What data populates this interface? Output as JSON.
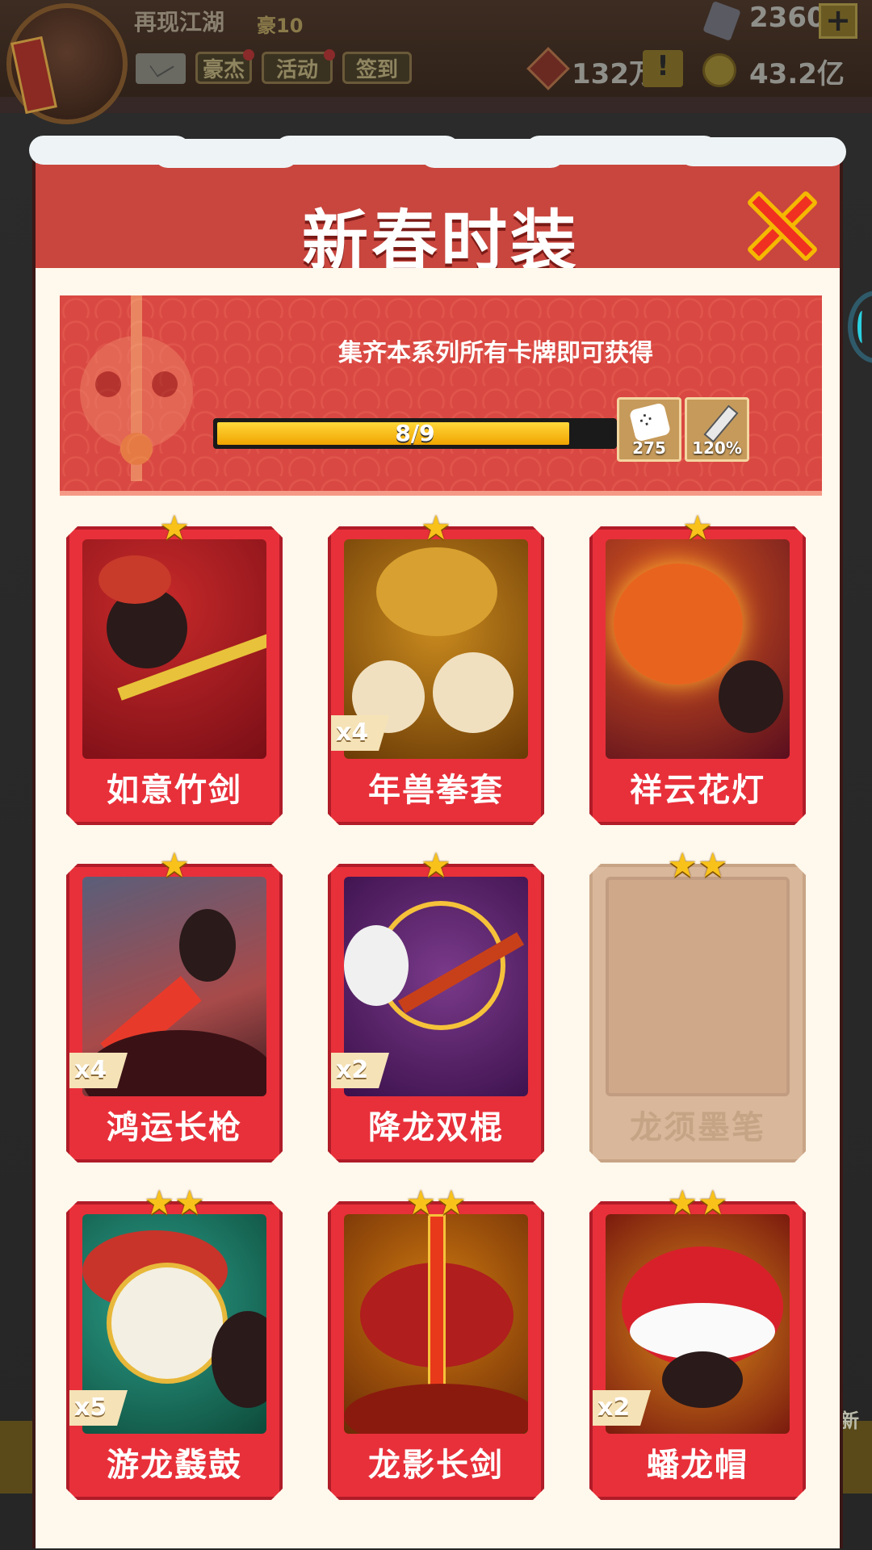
{
  "hud": {
    "player_name": "再现江湖",
    "player_level": "豪10",
    "buttons": [
      "豪杰",
      "活动",
      "签到"
    ],
    "gems": "2360",
    "plus_label": "+",
    "tickets": "132万",
    "warn_label": "!",
    "coins": "43.2亿",
    "new_label": "新"
  },
  "panel": {
    "title": "新春时装",
    "banner_text": "集齐本系列所有卡牌即可获得",
    "progress_text": "8/9",
    "progress_fraction": 0.889,
    "rewards": [
      {
        "icon": "dice-icon",
        "value": "275"
      },
      {
        "icon": "sword-icon",
        "value": "120%"
      }
    ]
  },
  "cards": [
    {
      "name": "如意竹剑",
      "stars": "★",
      "count": "",
      "locked": false
    },
    {
      "name": "年兽拳套",
      "stars": "★",
      "count": "x4",
      "locked": false
    },
    {
      "name": "祥云花灯",
      "stars": "★",
      "count": "",
      "locked": false
    },
    {
      "name": "鸿运长枪",
      "stars": "★",
      "count": "x4",
      "locked": false
    },
    {
      "name": "降龙双棍",
      "stars": "★",
      "count": "x2",
      "locked": false
    },
    {
      "name": "龙须墨笔",
      "stars": "★★",
      "count": "",
      "locked": true
    },
    {
      "name": "游龙鼗鼓",
      "stars": "★★",
      "count": "x5",
      "locked": false
    },
    {
      "name": "龙影长剑",
      "stars": "★★",
      "count": "",
      "locked": false
    },
    {
      "name": "蟠龙帽",
      "stars": "★★",
      "count": "x2",
      "locked": false
    }
  ],
  "colors": {
    "card_red": "#e8303a",
    "header_red": "#c8463e",
    "progress_yellow": "#ffd83a",
    "panel_cream": "#fff8ec",
    "locked_tan": "#d9b79a"
  }
}
